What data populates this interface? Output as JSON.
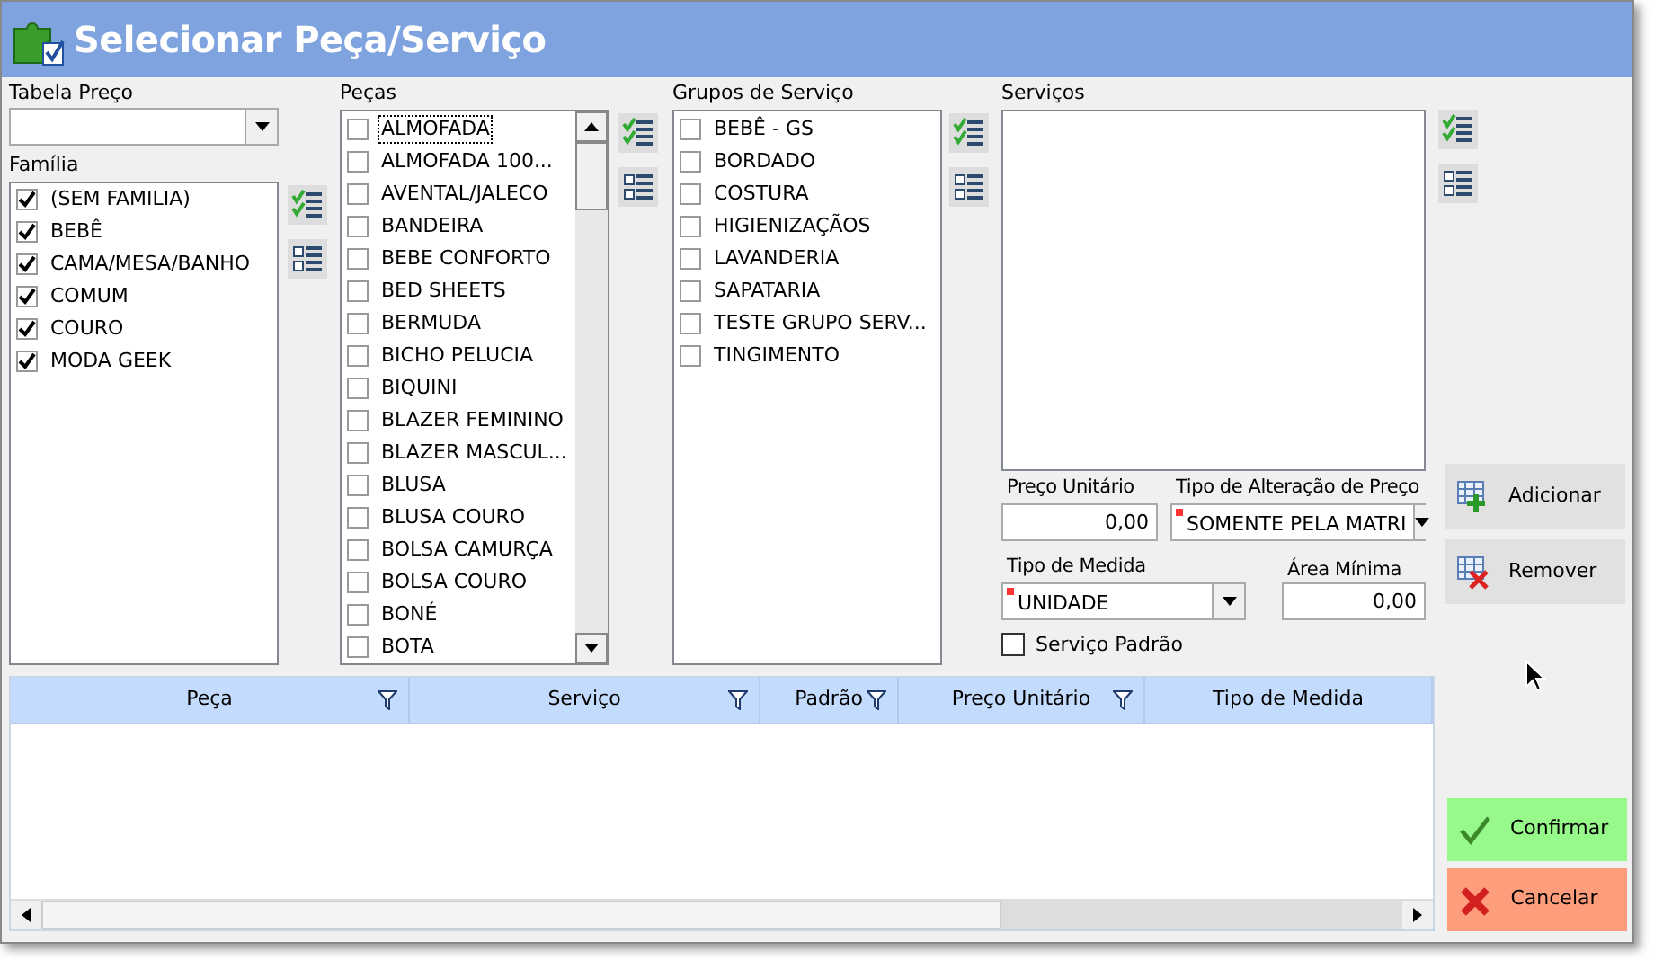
{
  "window": {
    "title": "Selecionar Peça/Serviço"
  },
  "tabela_preco": {
    "label": "Tabela Preço"
  },
  "familia": {
    "label": "Família",
    "items": [
      {
        "label": "(SEM FAMILIA)",
        "checked": true
      },
      {
        "label": "BEBÊ",
        "checked": true
      },
      {
        "label": "CAMA/MESA/BANHO",
        "checked": true
      },
      {
        "label": "COMUM",
        "checked": true
      },
      {
        "label": "COURO",
        "checked": true
      },
      {
        "label": "MODA GEEK",
        "checked": true
      }
    ]
  },
  "pecas": {
    "label": "Peças",
    "items": [
      {
        "label": "ALMOFADA",
        "checked": false,
        "focused": true
      },
      {
        "label": "ALMOFADA 100...",
        "checked": false,
        "focused": false
      },
      {
        "label": "AVENTAL/JALECO",
        "checked": false,
        "focused": false
      },
      {
        "label": "BANDEIRA",
        "checked": false,
        "focused": false
      },
      {
        "label": "BEBE CONFORTO",
        "checked": false,
        "focused": false
      },
      {
        "label": "BED SHEETS",
        "checked": false,
        "focused": false
      },
      {
        "label": "BERMUDA",
        "checked": false,
        "focused": false
      },
      {
        "label": "BICHO PELUCIA",
        "checked": false,
        "focused": false
      },
      {
        "label": "BIQUINI",
        "checked": false,
        "focused": false
      },
      {
        "label": "BLAZER FEMININO",
        "checked": false,
        "focused": false
      },
      {
        "label": "BLAZER MASCUL...",
        "checked": false,
        "focused": false
      },
      {
        "label": "BLUSA",
        "checked": false,
        "focused": false
      },
      {
        "label": "BLUSA COURO",
        "checked": false,
        "focused": false
      },
      {
        "label": "BOLSA CAMURÇA",
        "checked": false,
        "focused": false
      },
      {
        "label": "BOLSA COURO",
        "checked": false,
        "focused": false
      },
      {
        "label": "BONÉ",
        "checked": false,
        "focused": false
      },
      {
        "label": "BOTA",
        "checked": false,
        "focused": false
      }
    ]
  },
  "grupos_servico": {
    "label": "Grupos de Serviço",
    "items": [
      {
        "label": "BEBÊ - GS",
        "checked": false
      },
      {
        "label": "BORDADO",
        "checked": false
      },
      {
        "label": "COSTURA",
        "checked": false
      },
      {
        "label": "HIGIENIZAÇÃOS",
        "checked": false
      },
      {
        "label": "LAVANDERIA",
        "checked": false
      },
      {
        "label": "SAPATARIA",
        "checked": false
      },
      {
        "label": "TESTE GRUPO SERV...",
        "checked": false
      },
      {
        "label": "TINGIMENTO",
        "checked": false
      }
    ]
  },
  "servicos": {
    "label": "Serviços"
  },
  "preco_unitario": {
    "label": "Preço Unitário",
    "value": "0,00"
  },
  "tipo_alteracao_preco": {
    "label": "Tipo de Alteração de Preço",
    "value": "SOMENTE PELA MATRI",
    "required": true
  },
  "tipo_medida": {
    "label": "Tipo de Medida",
    "value": "UNIDADE",
    "required": true
  },
  "area_minima": {
    "label": "Área Mínima",
    "value": "0,00"
  },
  "servico_padrao": {
    "label": "Serviço Padrão",
    "checked": false
  },
  "actions": [
    {
      "label": "Adicionar",
      "kind": "add"
    },
    {
      "label": "Remover",
      "kind": "remove"
    }
  ],
  "grid": {
    "columns": [
      {
        "label": "Peça",
        "filter": true
      },
      {
        "label": "Serviço",
        "filter": true
      },
      {
        "label": "Padrão",
        "filter": true
      },
      {
        "label": "Preço Unitário",
        "filter": true
      },
      {
        "label": "Tipo de Medida",
        "filter": false
      }
    ]
  },
  "dialog_buttons": [
    {
      "label": "Confirmar",
      "kind": "confirm"
    },
    {
      "label": "Cancelar",
      "kind": "cancel"
    }
  ]
}
